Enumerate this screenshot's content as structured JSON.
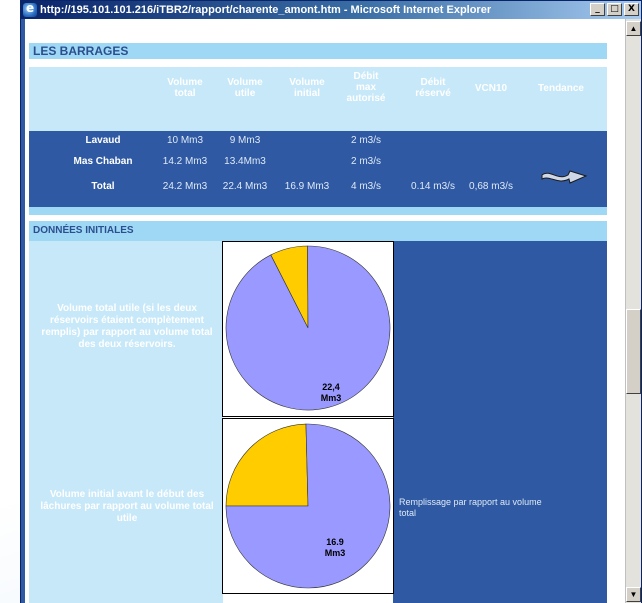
{
  "window": {
    "title": "http://195.101.101.216/iTBR2/rapport/charente_amont.htm - Microsoft Internet Explorer",
    "minimize_label": "_",
    "maximize_label": "□",
    "close_label": "X"
  },
  "colors": {
    "title_bar": "#0a246a",
    "section_header_bg": "#9fd8f5",
    "section_header_text": "#2b4f8e",
    "table_band": "#2f5aa3",
    "pie_main": "#9999ff",
    "pie_slice": "#ffcc00"
  },
  "barrages": {
    "section_title": "LES BARRAGES",
    "columns": [
      "Volume total",
      "Volume utile",
      "Volume initial",
      "Débit max autorisé",
      "Débit réservé",
      "VCN10",
      "Tendance"
    ],
    "column_lines": [
      [
        "Volume",
        "total"
      ],
      [
        "Volume",
        "utile"
      ],
      [
        "Volume",
        "initial"
      ],
      [
        "Débit",
        "max",
        "autorisé"
      ],
      [
        "Débit",
        "réservé"
      ],
      [
        "VCN10"
      ],
      [
        "Tendance"
      ]
    ],
    "rows": [
      {
        "name": "Lavaud",
        "volume_total": "10 Mm3",
        "volume_utile": "9 Mm3",
        "volume_initial": "",
        "debit_max": "2 m3/s",
        "debit_reserve": "",
        "vcn10": ""
      },
      {
        "name": "Mas Chaban",
        "volume_total": "14.2 Mm3",
        "volume_utile": "13.4Mm3",
        "volume_initial": "",
        "debit_max": "2 m3/s",
        "debit_reserve": "",
        "vcn10": ""
      },
      {
        "name": "Total",
        "volume_total": "24.2 Mm3",
        "volume_utile": "22.4 Mm3",
        "volume_initial": "16.9 Mm3",
        "debit_max": "4 m3/s",
        "debit_reserve": "0.14 m3/s",
        "vcn10": "0,68 m3/s"
      }
    ],
    "tendance_icon": "right-arrow-icon"
  },
  "donnees_initiales": {
    "section_title": "DONNÉES INITIALES",
    "pie1": {
      "description": "Volume total utile (si les deux réservoirs étaient complètement remplis) par rapport au volume total des deux réservoirs.",
      "label_value": "22,4",
      "label_unit": "Mm3",
      "main_fraction": 0.926,
      "slice_fraction": 0.074
    },
    "pie2": {
      "description": "Volume initial avant le début des lâchures par rapport au volume total utile",
      "label_value": "16.9",
      "label_unit": "Mm3",
      "main_fraction": 0.754,
      "slice_fraction": 0.246,
      "right_note": "Remplissage par rapport au volume total"
    }
  },
  "scrollbar": {
    "up_icon": "scroll-up-arrow-icon",
    "down_icon": "scroll-down-arrow-icon"
  }
}
